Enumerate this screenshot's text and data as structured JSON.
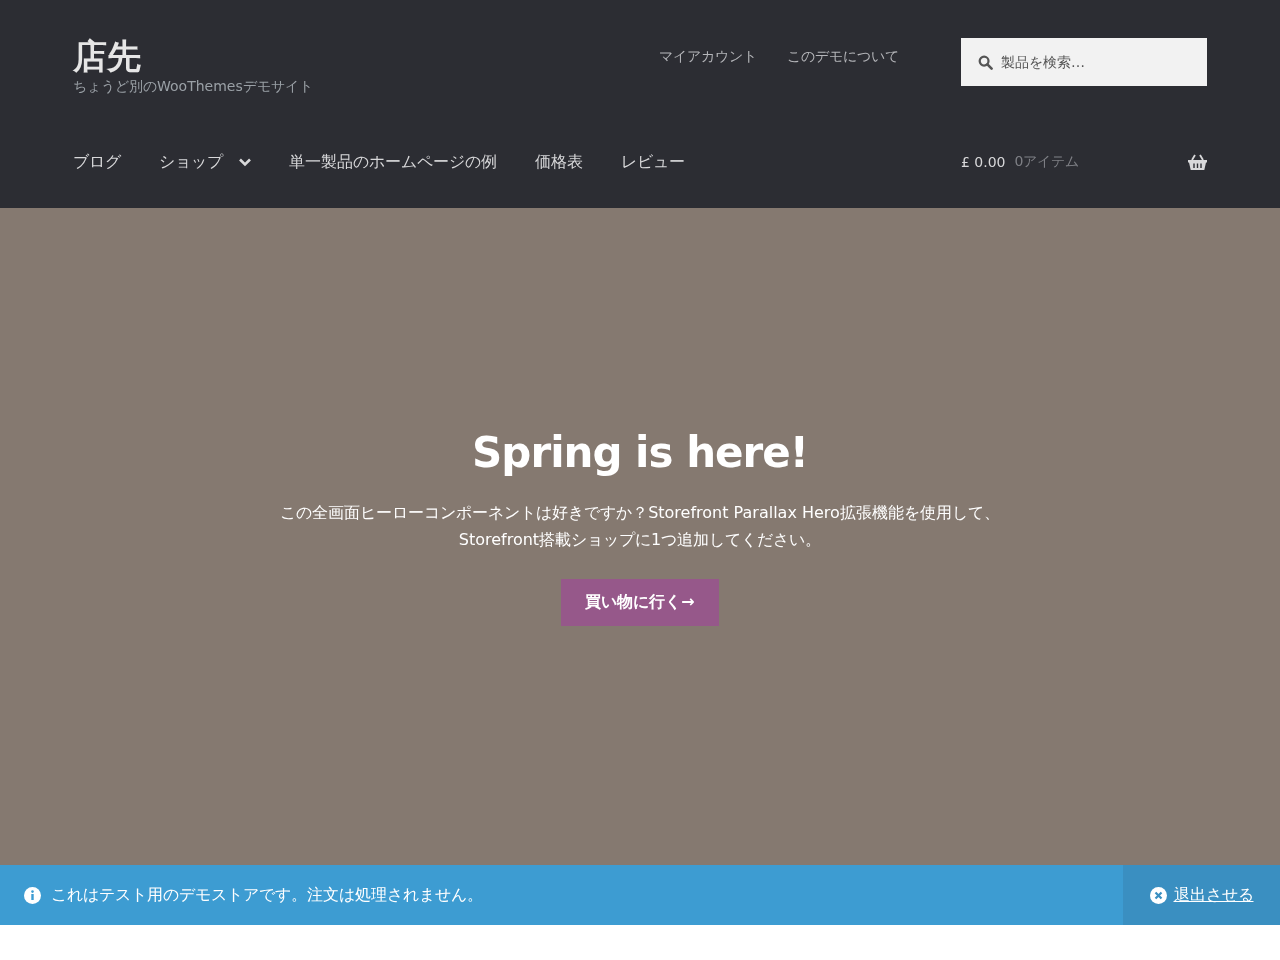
{
  "site": {
    "title": "店先",
    "tagline": "ちょうど別のWooThemesデモサイト"
  },
  "secondary_nav": [
    "マイアカウント",
    "このデモについて"
  ],
  "search": {
    "placeholder": "製品を検索…"
  },
  "primary_nav": [
    {
      "label": "ブログ",
      "has_submenu": false
    },
    {
      "label": "ショップ",
      "has_submenu": true
    },
    {
      "label": "単一製品のホームページの例",
      "has_submenu": false
    },
    {
      "label": "価格表",
      "has_submenu": false
    },
    {
      "label": "レビュー",
      "has_submenu": false
    }
  ],
  "cart": {
    "amount": "£ 0.00",
    "count": "0アイテム"
  },
  "hero": {
    "title": "Spring is here!",
    "text": "この全画面ヒーローコンポーネントは好きですか？Storefront Parallax Hero拡張機能を使用して、Storefront搭載ショップに1つ追加してください。",
    "button": "買い物に行く→"
  },
  "notice": {
    "text": "これはテスト用のデモストアです。注文は処理されません。",
    "dismiss": "退出させる"
  }
}
